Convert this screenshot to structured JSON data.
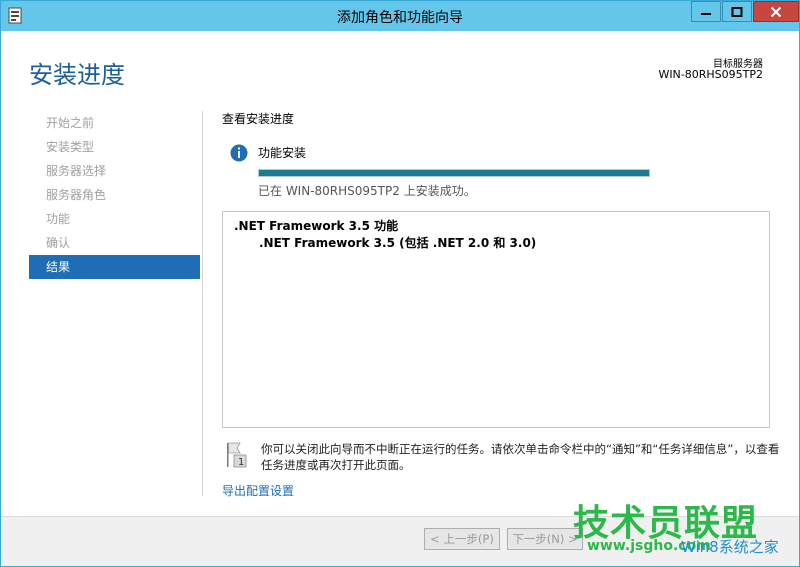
{
  "window": {
    "title": "添加角色和功能向导",
    "colors": {
      "titlebar": "#63c6ea",
      "accent": "#1e6db5",
      "close": "#c7463f"
    }
  },
  "header": {
    "title": "安装进度",
    "target_label": "目标服务器",
    "target_value": "WIN-80RHS095TP2"
  },
  "nav": {
    "items": [
      {
        "label": "开始之前",
        "active": false
      },
      {
        "label": "安装类型",
        "active": false
      },
      {
        "label": "服务器选择",
        "active": false
      },
      {
        "label": "服务器角色",
        "active": false
      },
      {
        "label": "功能",
        "active": false
      },
      {
        "label": "确认",
        "active": false
      },
      {
        "label": "结果",
        "active": true
      }
    ]
  },
  "main": {
    "section_title": "查看安装进度",
    "info_icon": "info-icon",
    "feature_install_label": "功能安装",
    "progress_percent": 100,
    "status": "已在 WIN-80RHS095TP2 上安装成功。",
    "results": {
      "feature": ".NET Framework 3.5 功能",
      "subfeature": ".NET Framework 3.5 (包括 .NET 2.0 和 3.0)"
    },
    "note": "你可以关闭此向导而不中断正在运行的任务。请依次单击命令栏中的“通知”和“任务详细信息”，以查看任务进度或再次打开此页面。",
    "export_link": "导出配置设置"
  },
  "footer": {
    "prev_label": "< 上一步(P)",
    "next_label": "下一步(N) >"
  },
  "watermark": {
    "line1": "技术员联盟",
    "line2": "www.jsgho.com",
    "line3": "Win8系统之家"
  }
}
